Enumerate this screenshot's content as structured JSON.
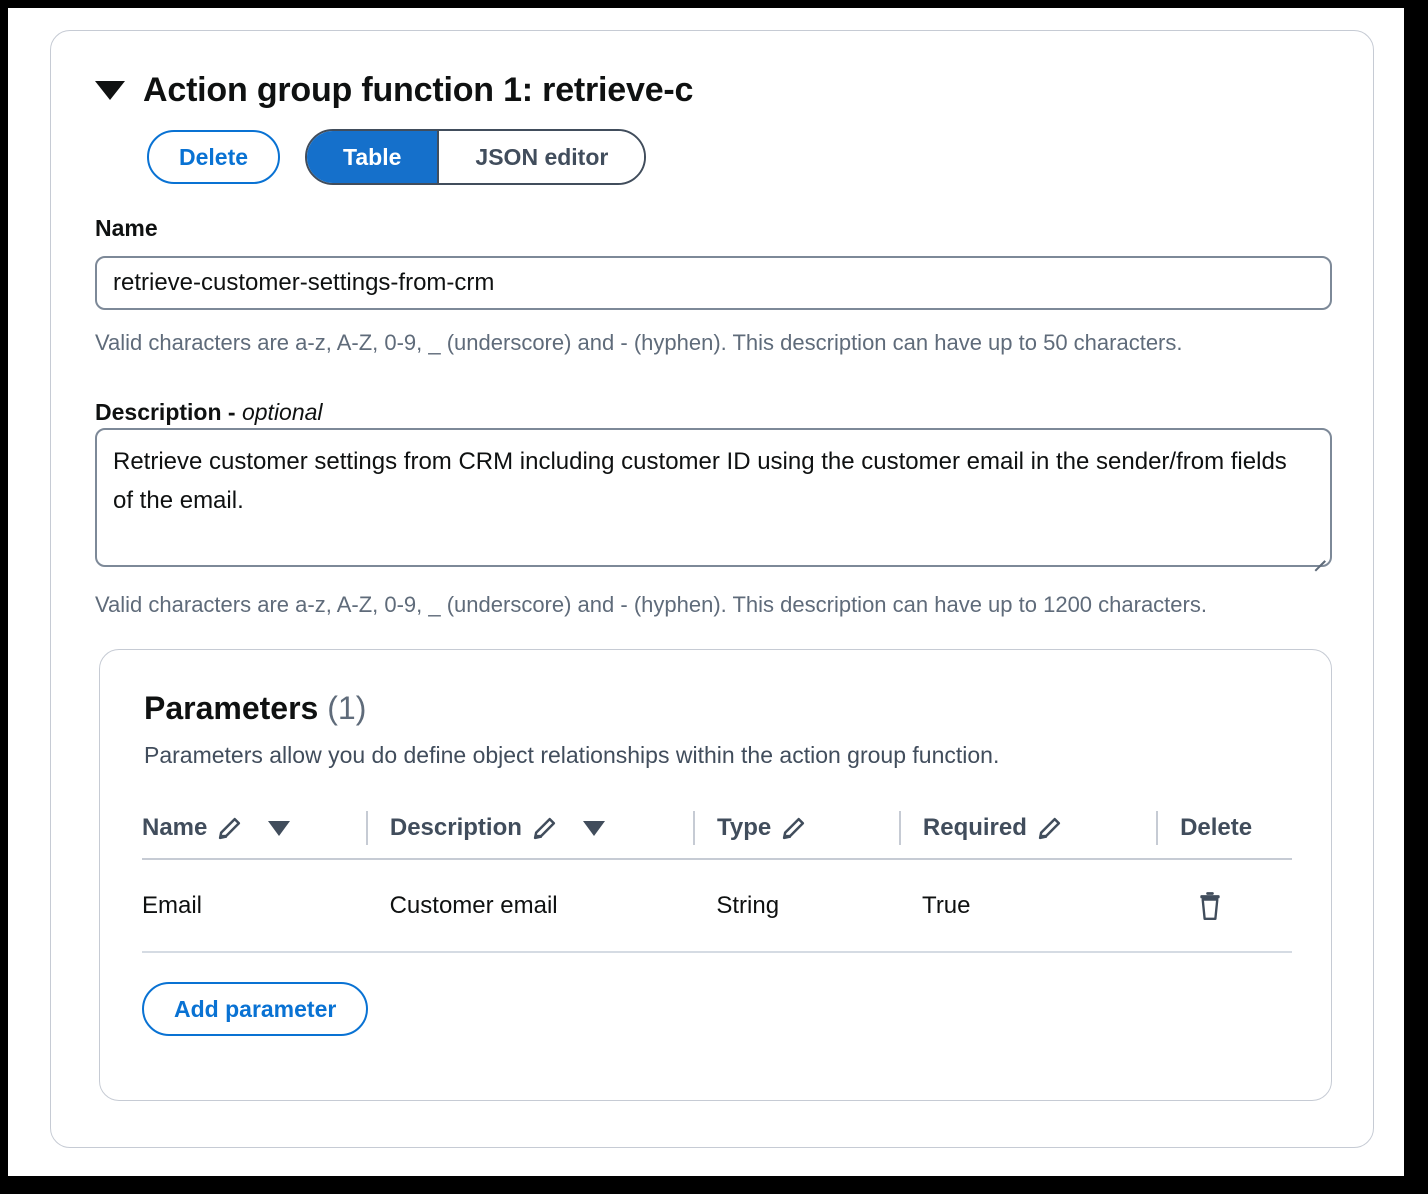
{
  "header": {
    "caret_icon": "caret-down-icon",
    "title": "Action group function 1: retrieve-c"
  },
  "actions": {
    "delete_label": "Delete",
    "view_modes": [
      {
        "label": "Table",
        "active": true
      },
      {
        "label": "JSON editor",
        "active": false
      }
    ]
  },
  "name_field": {
    "label": "Name",
    "value": "retrieve-customer-settings-from-crm",
    "placeholder": "",
    "helper": "Valid characters are a-z, A-Z, 0-9, _ (underscore) and - (hyphen). This description can have up to 50 characters."
  },
  "description_field": {
    "label": "Description - ",
    "label_optional": "optional",
    "value": "Retrieve customer settings from CRM including customer ID using the customer email in the sender/from fields of the email.",
    "placeholder": "",
    "helper": "Valid characters are a-z, A-Z, 0-9, _ (underscore) and - (hyphen). This description can have up to 1200 characters."
  },
  "parameters": {
    "title": "Parameters ",
    "count": "(1)",
    "subtitle": "Parameters allow you do define object relationships within the action group function.",
    "columns": [
      {
        "label": "Name",
        "edit_icon": "pencil-icon",
        "sort_icon": "sort-descending-icon"
      },
      {
        "label": "Description",
        "edit_icon": "pencil-icon",
        "sort_icon": "sort-descending-icon"
      },
      {
        "label": "Type",
        "edit_icon": "pencil-icon",
        "sort_icon": ""
      },
      {
        "label": "Required",
        "edit_icon": "pencil-icon",
        "sort_icon": ""
      },
      {
        "label": "Delete",
        "edit_icon": "",
        "sort_icon": ""
      }
    ],
    "rows": [
      {
        "name": "Email",
        "description": "Customer email",
        "type": "String",
        "required": "True",
        "delete_icon": "trash-icon"
      }
    ],
    "add_label": "Add parameter"
  },
  "colors": {
    "accent_blue": "#0972d3",
    "segment_active": "#1570cb",
    "border_gray": "#c6cbd4",
    "input_border": "#7d8998",
    "text_primary": "#0f1111",
    "text_muted": "#5f6b7a",
    "frame_black": "#000000"
  }
}
